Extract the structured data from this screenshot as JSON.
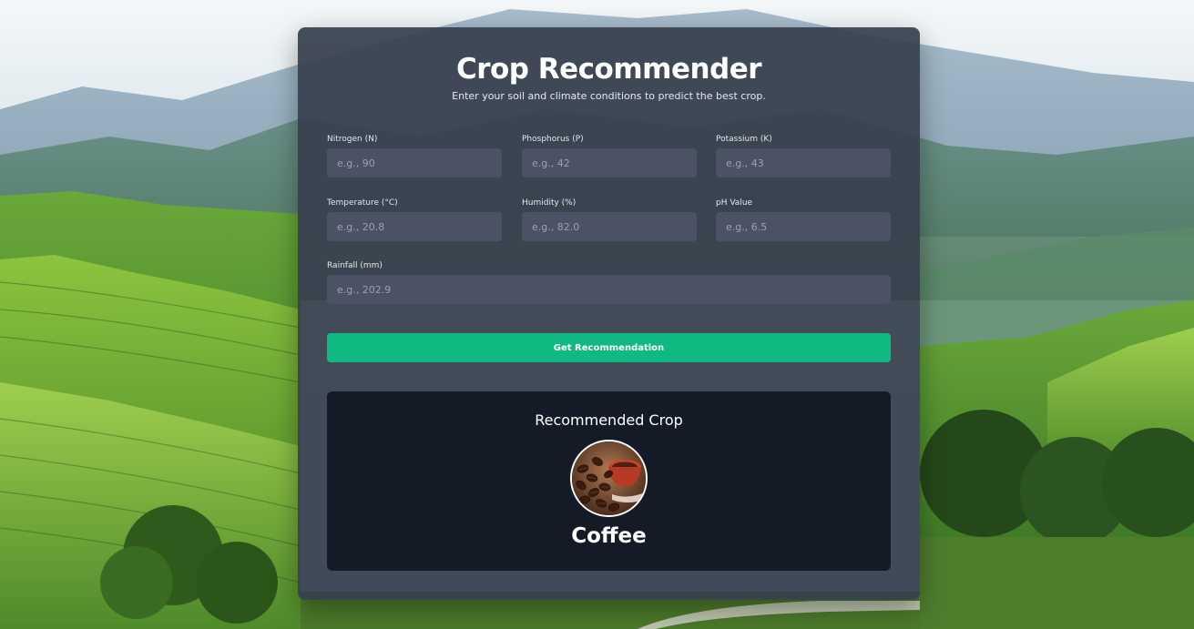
{
  "header": {
    "title": "Crop Recommender",
    "subtitle": "Enter your soil and climate conditions to predict the best crop."
  },
  "form": {
    "fields": [
      {
        "label": "Nitrogen (N)",
        "placeholder": "e.g., 90",
        "value": ""
      },
      {
        "label": "Phosphorus (P)",
        "placeholder": "e.g., 42",
        "value": ""
      },
      {
        "label": "Potassium (K)",
        "placeholder": "e.g., 43",
        "value": ""
      },
      {
        "label": "Temperature (°C)",
        "placeholder": "e.g., 20.8",
        "value": ""
      },
      {
        "label": "Humidity (%)",
        "placeholder": "e.g., 82.0",
        "value": ""
      },
      {
        "label": "pH Value",
        "placeholder": "e.g., 6.5",
        "value": ""
      },
      {
        "label": "Rainfall (mm)",
        "placeholder": "e.g., 202.9",
        "value": ""
      }
    ],
    "submit_label": "Get Recommendation"
  },
  "result": {
    "title": "Recommended Crop",
    "crop": "Coffee",
    "image_icon": "coffee-beans-image"
  },
  "colors": {
    "accent": "#10b981",
    "card": "#373f4e",
    "input": "#4a5263",
    "result_panel": "#151a27"
  }
}
